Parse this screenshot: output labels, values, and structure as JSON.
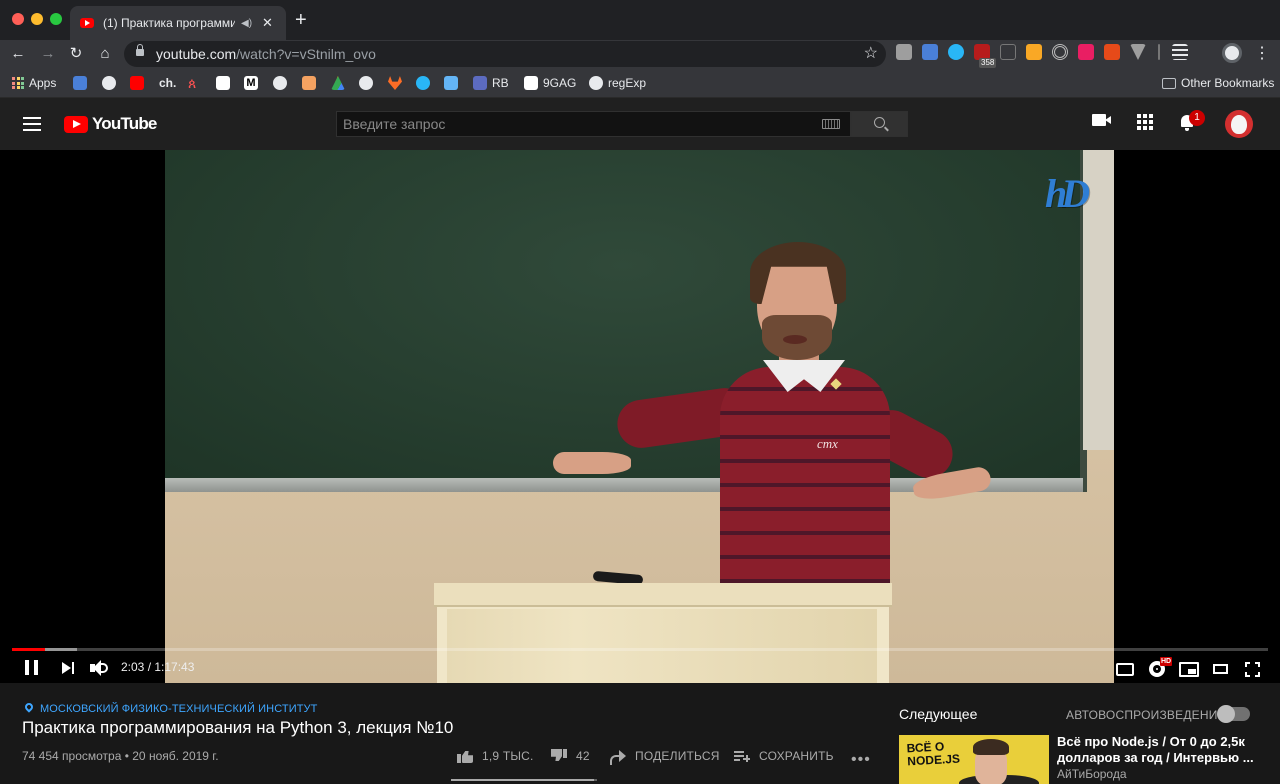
{
  "browser": {
    "tab_title": "(1) Практика программиро",
    "url_host": "youtube.com",
    "url_path": "/watch?v=vStnilm_ovo",
    "extension_badge": "358",
    "bookmarks": {
      "apps": "Apps",
      "ch": "ch.",
      "m": "M",
      "rb": "RB",
      "ninegag": "9GAG",
      "regexp": "regExp",
      "other": "Other Bookmarks"
    }
  },
  "youtube": {
    "logo_text": "YouTube",
    "search_placeholder": "Введите запрос",
    "notification_count": "1"
  },
  "player": {
    "current_time": "2:03",
    "duration": "1:17:43",
    "time_display": "2:03 / 1:17:43",
    "played_fraction": 0.026,
    "buffered_fraction": 0.052,
    "hd_badge": "HD",
    "sweater_logo": "cmx"
  },
  "video": {
    "hashtag": "МОСКОВСКИЙ ФИЗИКО-ТЕХНИЧЕСКИЙ ИНСТИТУТ",
    "title": "Практика программирования на Python 3, лекция №10",
    "views_date": "74 454 просмотра • 20 нояб. 2019 г.",
    "likes": "1,9 ТЫС.",
    "dislikes": "42",
    "share_label": "ПОДЕЛИТЬСЯ",
    "save_label": "СОХРАНИТЬ",
    "like_ratio": 0.978
  },
  "sidebar": {
    "next_label": "Следующее",
    "autoplay_label": "АВТОВОСПРОИЗВЕДЕНИЕ",
    "recommendation": {
      "thumb_text_1": "ВСЁ О",
      "thumb_text_2": "NODE.JS",
      "title": "Всё про Node.js / От 0 до 2,5к долларов за год / Интервью ...",
      "channel": "АйТиБорода"
    }
  },
  "colors": {
    "yt_red": "#ff0000",
    "link_blue": "#3ea6ff",
    "background": "#181818"
  }
}
